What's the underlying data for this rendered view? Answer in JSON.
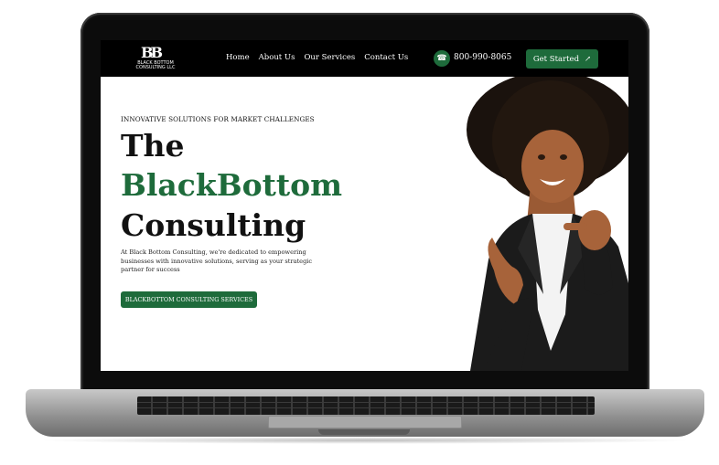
{
  "nav": {
    "logo_mark": "BB",
    "logo_text": "BLACK BOTTOM CONSULTING LLC",
    "links": [
      "Home",
      "About Us",
      "Our Services",
      "Contact Us"
    ],
    "phone": "800-990-8065",
    "cta_label": "Get Started"
  },
  "hero": {
    "eyebrow": "INNOVATIVE SOLUTIONS FOR MARKET CHALLENGES",
    "title_line1": "The",
    "title_line2": "BlackBottom",
    "title_line3": "Consulting",
    "description": "At Black Bottom Consulting, we're dedicated to empowering businesses with innovative solutions, serving as your strategic partner for success",
    "button_label": "BLACKBOTTOM CONSULTING SERVICES"
  },
  "colors": {
    "brand_green": "#1e6b3b",
    "nav_bg": "#000000",
    "text_dark": "#111111"
  },
  "icons": {
    "phone": "phone-icon",
    "arrow": "arrow-up-right-icon"
  }
}
